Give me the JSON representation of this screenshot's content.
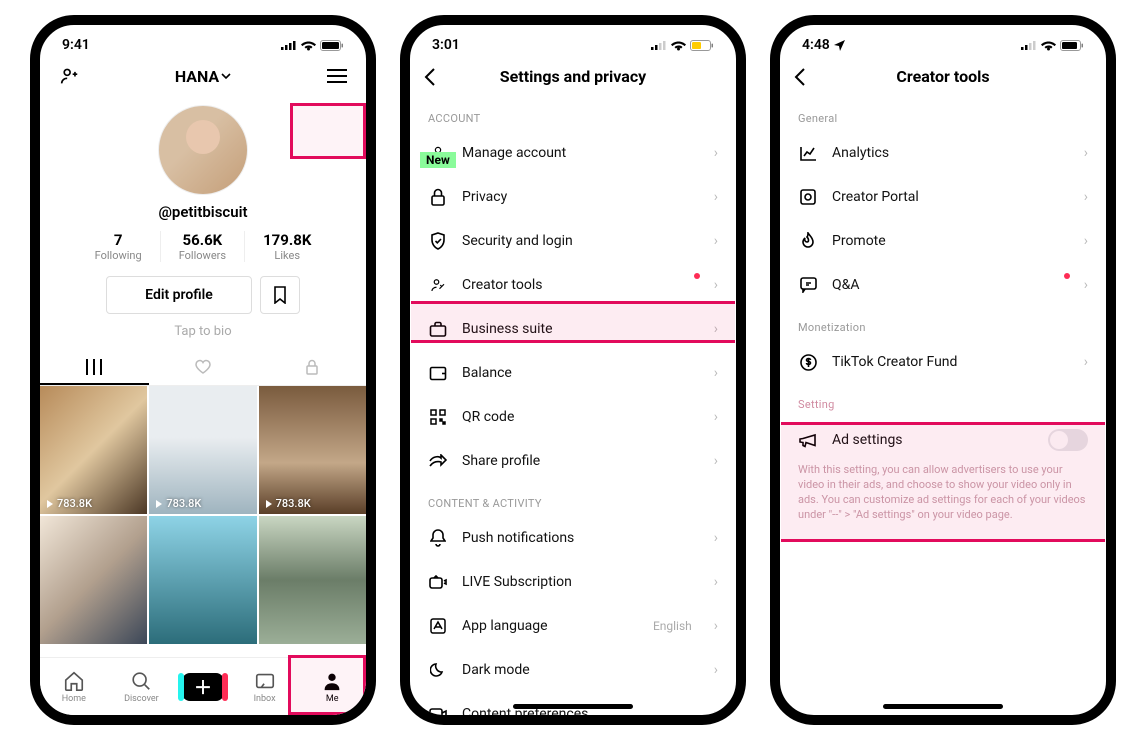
{
  "screen1": {
    "status_time": "9:41",
    "nav_title": "HANA",
    "handle": "@petitbiscuit",
    "stats": {
      "following_num": "7",
      "following_lbl": "Following",
      "followers_num": "56.6K",
      "followers_lbl": "Followers",
      "likes_num": "179.8K",
      "likes_lbl": "Likes"
    },
    "edit_profile": "Edit profile",
    "bio": "Tap to bio",
    "plays": "783.8K",
    "bottom_nav": {
      "home": "Home",
      "discover": "Discover",
      "inbox": "Inbox",
      "me": "Me"
    }
  },
  "screen2": {
    "status_time": "3:01",
    "title": "Settings and privacy",
    "new_badge": "New",
    "sections": {
      "account": "ACCOUNT",
      "content": "CONTENT & ACTIVITY"
    },
    "rows": {
      "manage": "Manage account",
      "privacy": "Privacy",
      "security": "Security and login",
      "creator": "Creator tools",
      "business": "Business suite",
      "balance": "Balance",
      "qr": "QR code",
      "share": "Share profile",
      "push": "Push notifications",
      "live": "LIVE Subscription",
      "lang": "App language",
      "lang_value": "English",
      "dark": "Dark mode",
      "content_pref": "Content preferences"
    }
  },
  "screen3": {
    "status_time": "4:48",
    "title": "Creator tools",
    "sections": {
      "general": "General",
      "monetization": "Monetization",
      "setting": "Setting"
    },
    "rows": {
      "analytics": "Analytics",
      "portal": "Creator Portal",
      "promote": "Promote",
      "qa": "Q&A",
      "fund": "TikTok Creator Fund",
      "ad": "Ad settings"
    },
    "ad_desc": "With this setting, you can allow advertisers to use your video in their ads, and choose to show your video only in ads. You can customize ad settings for each of your videos under  \"--\" > \"Ad settings\" on your video page."
  }
}
